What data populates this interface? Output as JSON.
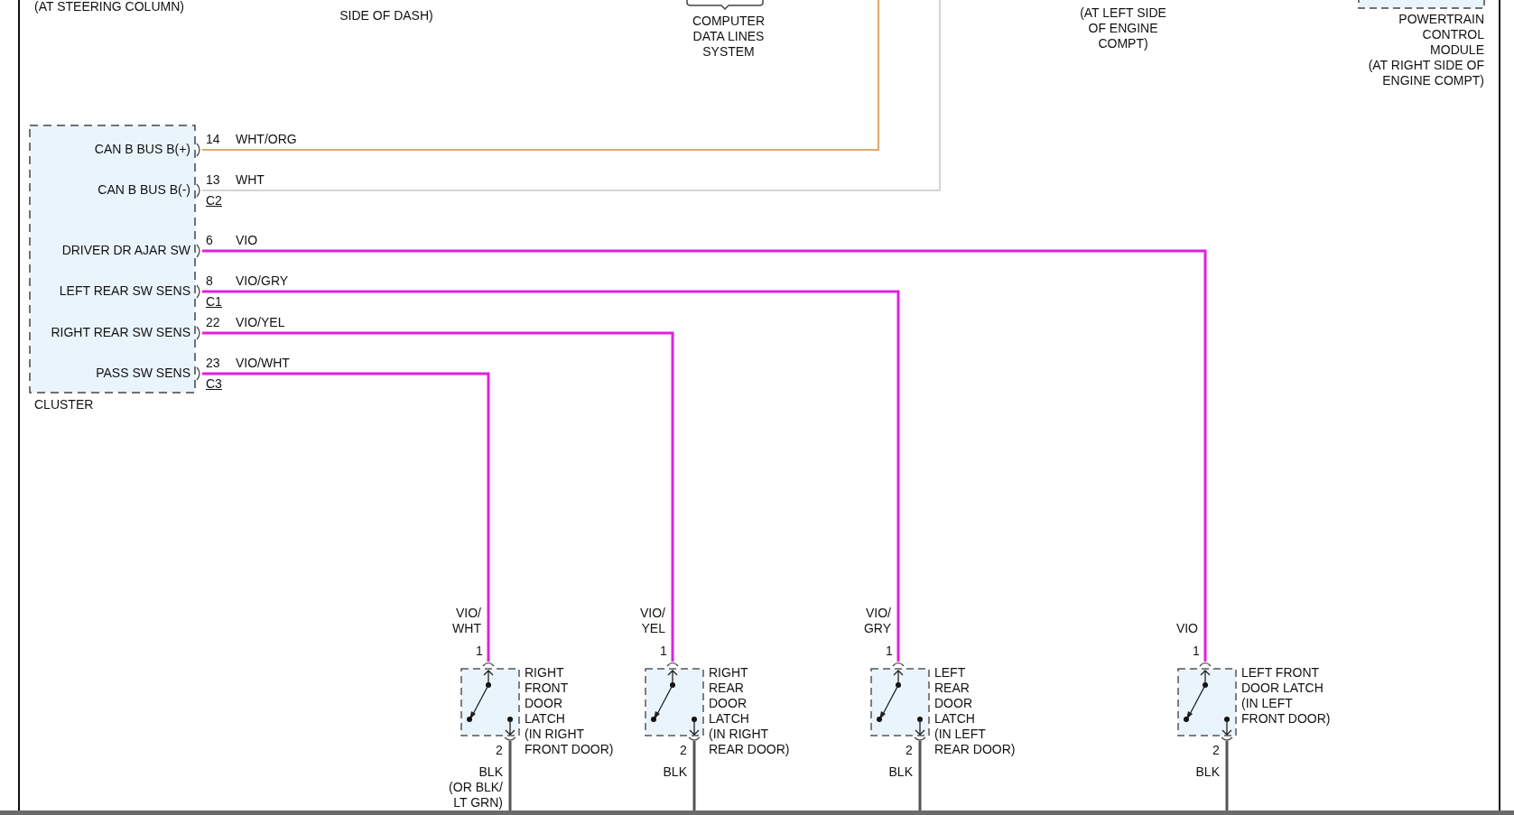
{
  "header_labels": [
    {
      "text": "(AT STEERING COLUMN)"
    },
    {
      "text": "SIDE OF DASH)"
    },
    {
      "text": "COMPUTER\nDATA LINES\nSYSTEM"
    },
    {
      "text": "(AT LEFT SIDE\nOF ENGINE\nCOMPT)"
    },
    {
      "text": "POWERTRAIN\nCONTROL\nMODULE\n(AT RIGHT SIDE OF\nENGINE COMPT)"
    }
  ],
  "cluster": {
    "name": "CLUSTER",
    "pins": [
      {
        "label": "CAN B BUS B(+)",
        "number": "14",
        "wire": "WHT/ORG",
        "color": "#e2a66c"
      },
      {
        "label": "CAN B BUS B(-)",
        "number": "13",
        "wire": "WHT",
        "color": "#d4d4d4",
        "connector": "C2"
      },
      {
        "label": "DRIVER DR AJAR SW",
        "number": "6",
        "wire": "VIO",
        "color": "#e020e0"
      },
      {
        "label": "LEFT REAR SW SENS",
        "number": "8",
        "wire": "VIO/GRY",
        "color": "#e020e0",
        "connector": "C1"
      },
      {
        "label": "RIGHT REAR SW SENS",
        "number": "22",
        "wire": "VIO/YEL",
        "color": "#e020e0"
      },
      {
        "label": "PASS SW SENS",
        "number": "23",
        "wire": "VIO/WHT",
        "color": "#e020e0",
        "connector": "C3"
      }
    ]
  },
  "switches": [
    {
      "wire_label": "VIO/\nWHT",
      "pin_in": "1",
      "name": "RIGHT\nFRONT\nDOOR\nLATCH\n(IN RIGHT\nFRONT DOOR)",
      "pin_out": "2",
      "ground_label": "BLK\n(OR BLK/\nLT GRN)"
    },
    {
      "wire_label": "VIO/\nYEL",
      "pin_in": "1",
      "name": "RIGHT\nREAR\nDOOR\nLATCH\n(IN RIGHT\nREAR DOOR)",
      "pin_out": "2",
      "ground_label": "BLK"
    },
    {
      "wire_label": "VIO/\nGRY",
      "pin_in": "1",
      "name": "LEFT\nREAR\nDOOR\nLATCH\n(IN LEFT\nREAR DOOR)",
      "pin_out": "2",
      "ground_label": "BLK"
    },
    {
      "wire_label": "VIO",
      "pin_in": "1",
      "name": "LEFT FRONT\nDOOR LATCH\n(IN LEFT\nFRONT DOOR)",
      "pin_out": "2",
      "ground_label": "BLK"
    }
  ]
}
